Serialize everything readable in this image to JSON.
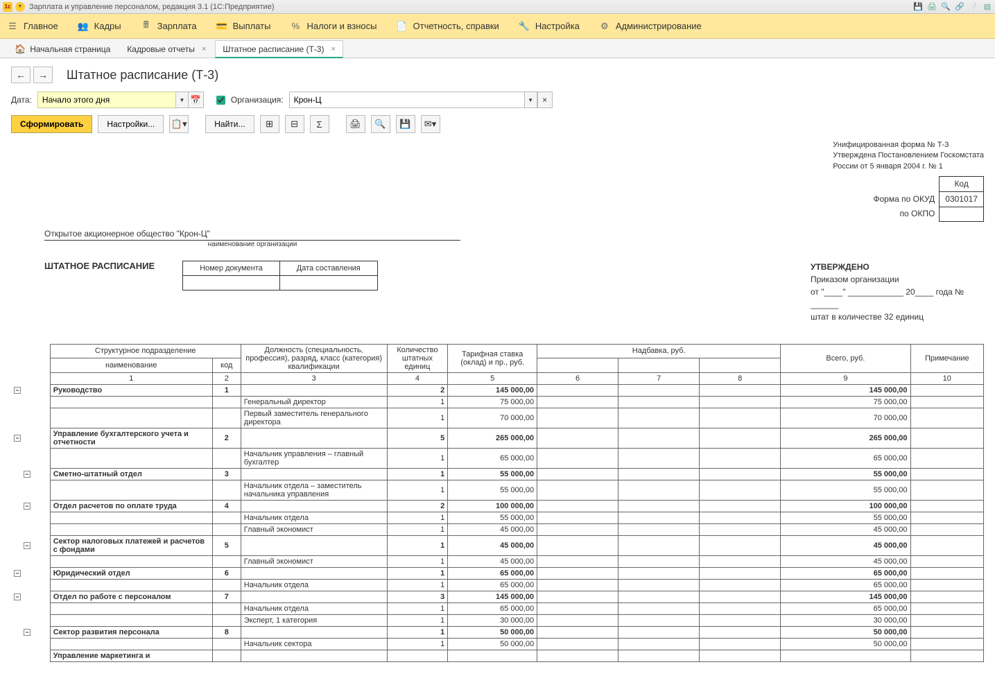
{
  "titlebar": {
    "app_title": "Зарплата и управление персоналом, редакция 3.1  (1С:Предприятие)"
  },
  "mainmenu": [
    {
      "label": "Главное"
    },
    {
      "label": "Кадры"
    },
    {
      "label": "Зарплата"
    },
    {
      "label": "Выплаты"
    },
    {
      "label": "Налоги и взносы"
    },
    {
      "label": "Отчетность, справки"
    },
    {
      "label": "Настройка"
    },
    {
      "label": "Администрирование"
    }
  ],
  "tabs": [
    {
      "label": "Начальная страница",
      "home": true
    },
    {
      "label": "Кадровые отчеты",
      "closable": true
    },
    {
      "label": "Штатное расписание (Т-3)",
      "closable": true,
      "active": true
    }
  ],
  "page": {
    "title": "Штатное расписание (Т-3)",
    "date_label": "Дата:",
    "date_value": "Начало этого дня",
    "org_label": "Организация:",
    "org_value": "Крон-Ц"
  },
  "toolbar": {
    "generate": "Сформировать",
    "settings": "Настройки...",
    "find": "Найти..."
  },
  "form": {
    "unif": "Унифицированная форма № Т-3",
    "approved_by": "Утверждена Постановлением Госкомстата",
    "russia_date": "России от 5 января 2004 г. № 1",
    "code_label": "Код",
    "okud_label": "Форма по ОКУД",
    "okud_value": "0301017",
    "okpo_label": "по ОКПО",
    "okpo_value": "",
    "org_name": "Открытое акционерное общество \"Крон-Ц\"",
    "org_sub": "наименование организации",
    "doc_title": "ШТАТНОЕ РАСПИСАНИЕ",
    "doc_num_hdr": "Номер документа",
    "doc_date_hdr": "Дата составления",
    "approved": "УТВЕРЖДЕНО",
    "order_of": "Приказом организации",
    "from_year_no": "от \"____\" ____________ 20____ года № ______",
    "staff_count": "штат в количестве 32 единиц"
  },
  "table": {
    "headers": {
      "struct": "Структурное  подразделение",
      "name": "наименование",
      "code": "код",
      "position": "Должность (специальность, профессия), разряд, класс (категория) квалификации",
      "units": "Количество штатных единиц",
      "rate": "Тарифная ставка (оклад) и пр., руб.",
      "bonus": "Надбавка, руб.",
      "total": "Всего, руб.",
      "note": "Примечание"
    },
    "colnums": [
      "1",
      "2",
      "3",
      "4",
      "5",
      "6",
      "7",
      "8",
      "9",
      "10"
    ],
    "rows": [
      {
        "type": "dept",
        "name": "Руководство",
        "code": "1",
        "units": "2",
        "rate": "145 000,00",
        "total": "145 000,00"
      },
      {
        "type": "pos",
        "position": "Генеральный директор",
        "units": "1",
        "rate": "75 000,00",
        "total": "75 000,00"
      },
      {
        "type": "pos",
        "position": "Первый заместитель генерального директора",
        "units": "1",
        "rate": "70 000,00",
        "total": "70 000,00"
      },
      {
        "type": "dept",
        "name": "Управление бухгалтерского учета и отчетности",
        "code": "2",
        "units": "5",
        "rate": "265 000,00",
        "total": "265 000,00"
      },
      {
        "type": "pos",
        "position": "Начальник управления – главный бухгалтер",
        "units": "1",
        "rate": "65 000,00",
        "total": "65 000,00"
      },
      {
        "type": "dept",
        "name": "Сметно-штатный отдел",
        "code": "3",
        "units": "1",
        "rate": "55 000,00",
        "total": "55 000,00",
        "indent": 1
      },
      {
        "type": "pos",
        "position": "Начальник отдела – заместитель начальника управления",
        "units": "1",
        "rate": "55 000,00",
        "total": "55 000,00"
      },
      {
        "type": "dept",
        "name": "Отдел расчетов по оплате труда",
        "code": "4",
        "units": "2",
        "rate": "100 000,00",
        "total": "100 000,00",
        "indent": 1
      },
      {
        "type": "pos",
        "position": "Начальник отдела",
        "units": "1",
        "rate": "55 000,00",
        "total": "55 000,00"
      },
      {
        "type": "pos",
        "position": "Главный экономист",
        "units": "1",
        "rate": "45 000,00",
        "total": "45 000,00"
      },
      {
        "type": "dept",
        "name": "Сектор налоговых платежей и расчетов с фондами",
        "code": "5",
        "units": "1",
        "rate": "45 000,00",
        "total": "45 000,00",
        "indent": 1
      },
      {
        "type": "pos",
        "position": "Главный экономист",
        "units": "1",
        "rate": "45 000,00",
        "total": "45 000,00"
      },
      {
        "type": "dept",
        "name": "Юридический отдел",
        "code": "6",
        "units": "1",
        "rate": "65 000,00",
        "total": "65 000,00"
      },
      {
        "type": "pos",
        "position": "Начальник отдела",
        "units": "1",
        "rate": "65 000,00",
        "total": "65 000,00"
      },
      {
        "type": "dept",
        "name": "Отдел по работе с персоналом",
        "code": "7",
        "units": "3",
        "rate": "145 000,00",
        "total": "145 000,00"
      },
      {
        "type": "pos",
        "position": "Начальник отдела",
        "units": "1",
        "rate": "65 000,00",
        "total": "65 000,00"
      },
      {
        "type": "pos",
        "position": "Эксперт, 1 категория",
        "units": "1",
        "rate": "30 000,00",
        "total": "30 000,00"
      },
      {
        "type": "dept",
        "name": "Сектор развития персонала",
        "code": "8",
        "units": "1",
        "rate": "50 000,00",
        "total": "50 000,00",
        "indent": 1
      },
      {
        "type": "pos",
        "position": "Начальник сектора",
        "units": "1",
        "rate": "50 000,00",
        "total": "50 000,00"
      },
      {
        "type": "dept",
        "name": "Управление маркетинга и",
        "code": "",
        "units": "",
        "rate": "",
        "total": "",
        "partial": true
      }
    ]
  }
}
